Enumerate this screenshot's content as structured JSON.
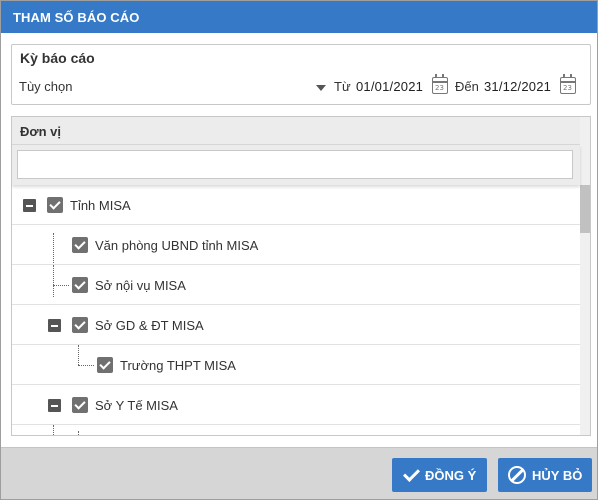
{
  "dialog": {
    "title": "THAM SỐ BÁO CÁO"
  },
  "period": {
    "legend": "Kỳ báo cáo",
    "option_value": "Tùy chọn",
    "from_label": "Từ",
    "from_date": "01/01/2021",
    "to_label": "Đến",
    "to_date": "31/12/2021",
    "calendar_day": "23"
  },
  "units": {
    "column_header": "Đơn vị",
    "filter_value": "",
    "rows": [
      {
        "label": "Tỉnh MISA",
        "checked": true,
        "level": 0,
        "expandable": true
      },
      {
        "label": "Văn phòng UBND tỉnh MISA",
        "checked": true,
        "level": 1,
        "expandable": false
      },
      {
        "label": "Sở nội vụ MISA",
        "checked": true,
        "level": 1,
        "expandable": false
      },
      {
        "label": "Sở GD & ĐT MISA",
        "checked": true,
        "level": 1,
        "expandable": true
      },
      {
        "label": "Trường THPT MISA",
        "checked": true,
        "level": 2,
        "expandable": false
      },
      {
        "label": "Sở Y Tế MISA",
        "checked": true,
        "level": 1,
        "expandable": true
      }
    ]
  },
  "footer": {
    "ok_label": "ĐỒNG Ý",
    "cancel_label": "HỦY BỎ"
  },
  "colors": {
    "primary": "#3679c6",
    "footer_bg": "#d6d6d6",
    "checkbox": "#707070"
  }
}
